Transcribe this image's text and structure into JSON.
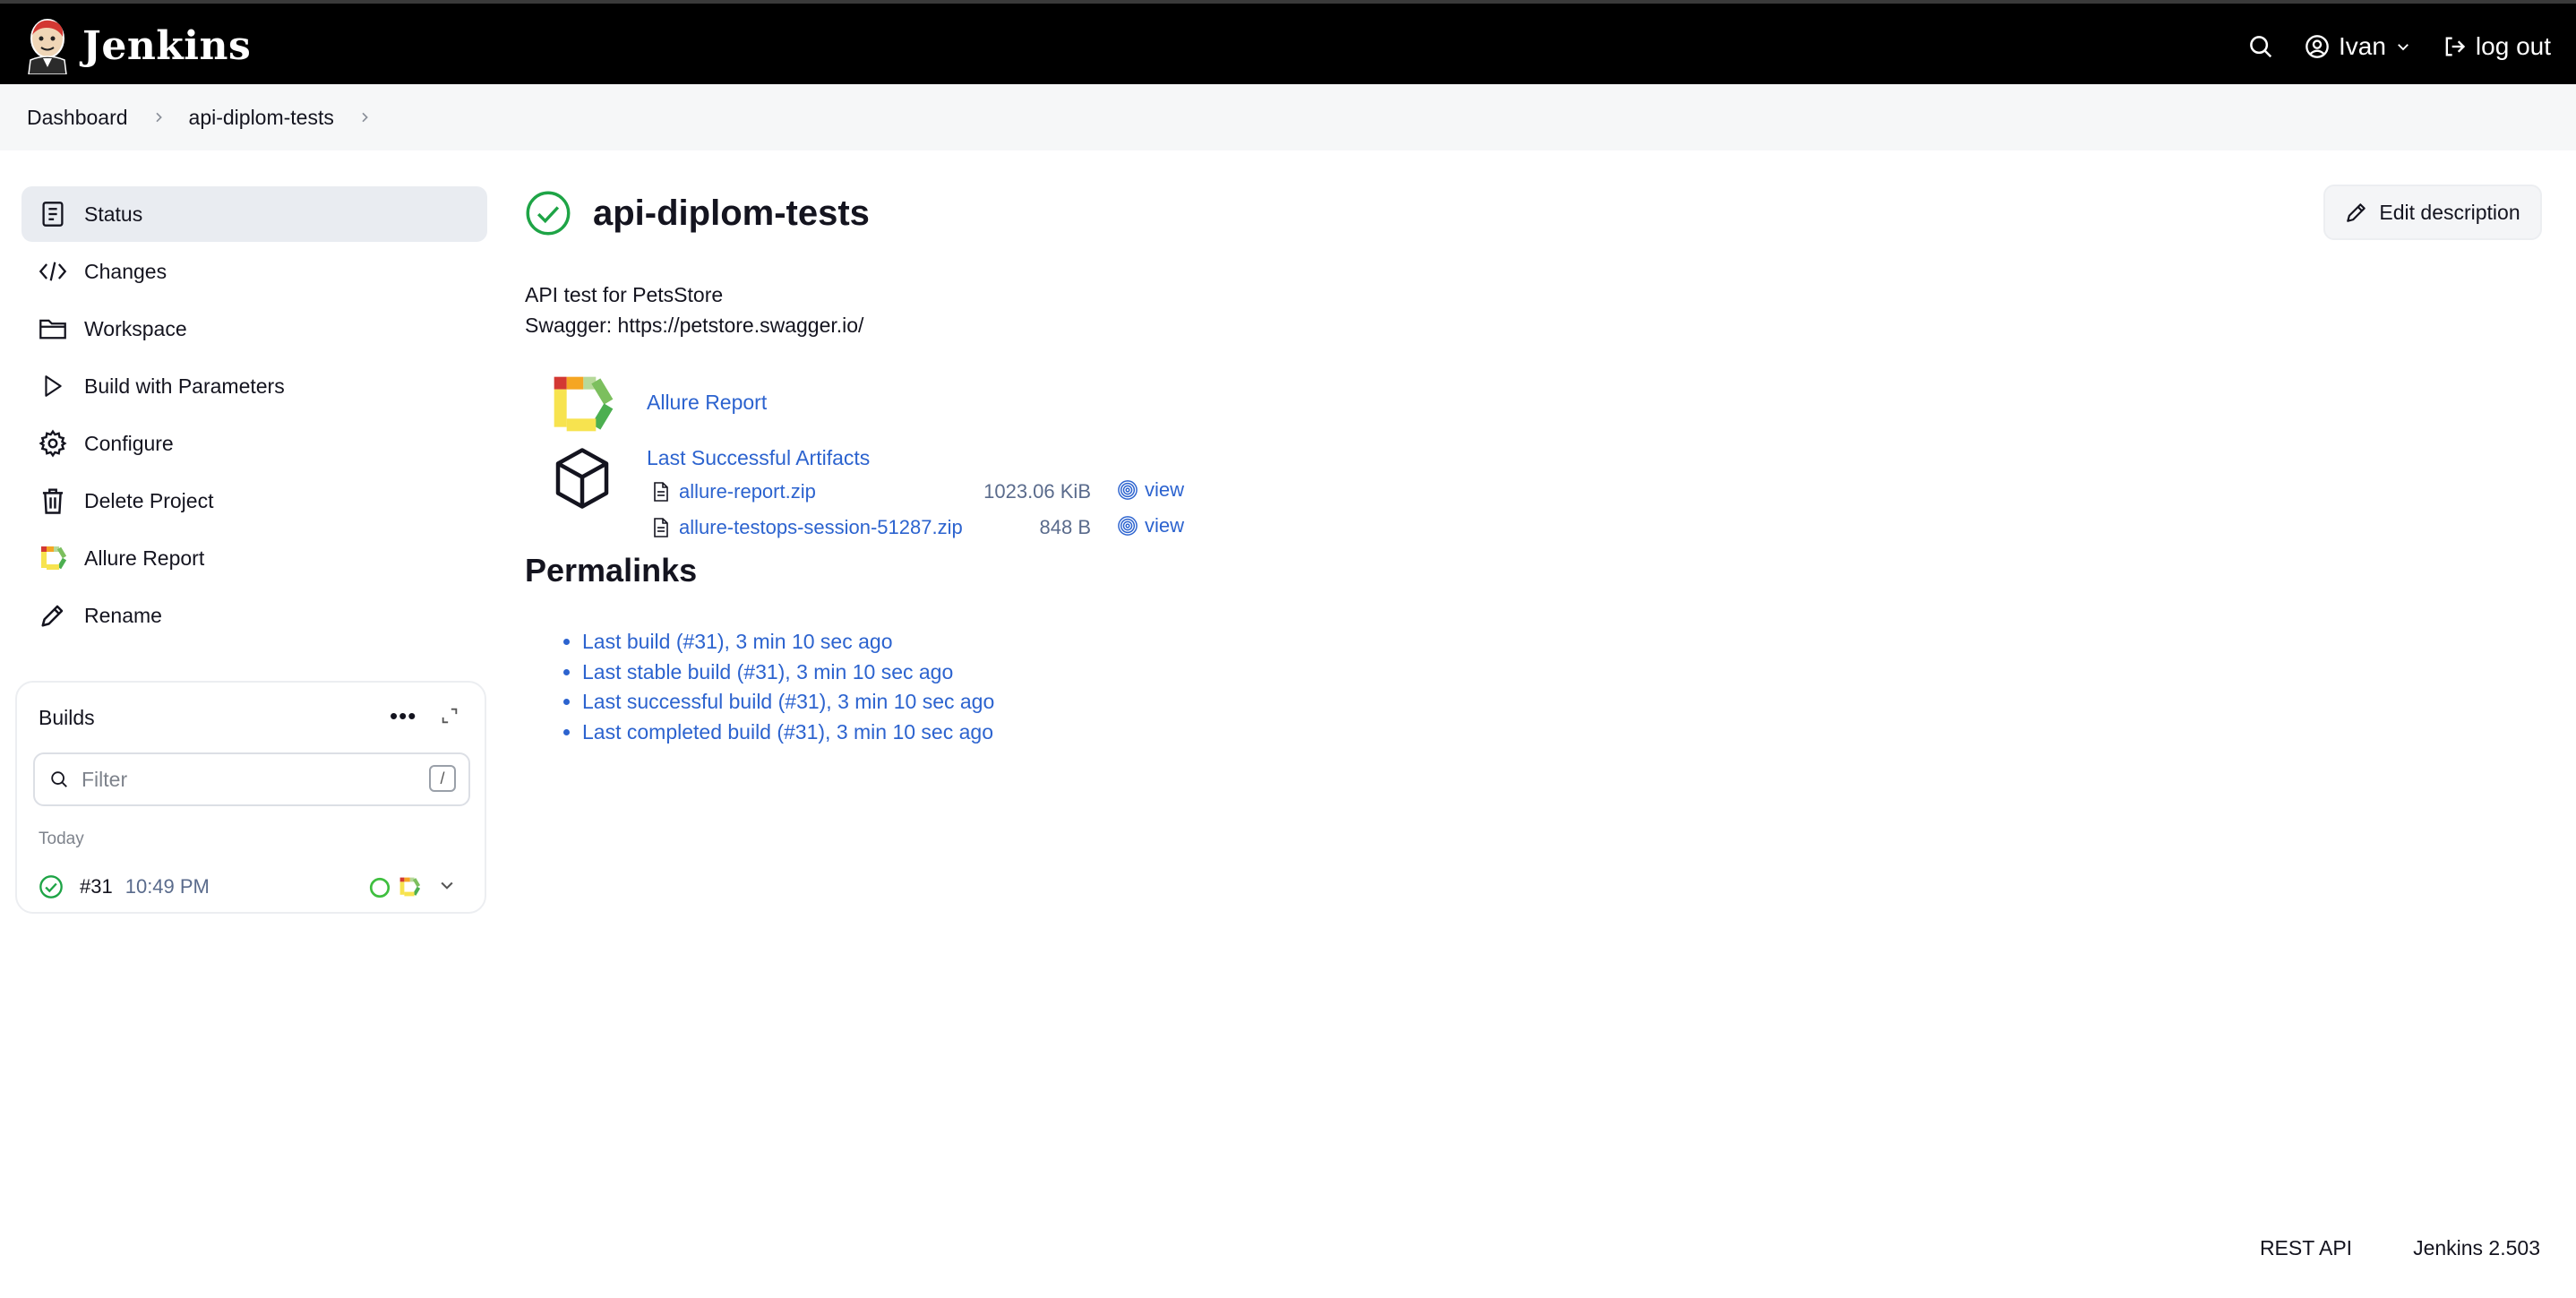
{
  "header": {
    "brand": "Jenkins",
    "user": "Ivan",
    "logout": "log out"
  },
  "breadcrumb": [
    "Dashboard",
    "api-diplom-tests"
  ],
  "sidebar": {
    "items": [
      {
        "label": "Status",
        "icon": "status-icon"
      },
      {
        "label": "Changes",
        "icon": "code-icon"
      },
      {
        "label": "Workspace",
        "icon": "folder-icon"
      },
      {
        "label": "Build with Parameters",
        "icon": "play-icon"
      },
      {
        "label": "Configure",
        "icon": "gear-icon"
      },
      {
        "label": "Delete Project",
        "icon": "trash-icon"
      },
      {
        "label": "Allure Report",
        "icon": "allure-icon"
      },
      {
        "label": "Rename",
        "icon": "pencil-icon"
      }
    ],
    "builds": {
      "title": "Builds",
      "filter_placeholder": "Filter",
      "filter_shortcut": "/",
      "group": "Today",
      "rows": [
        {
          "number": "#31",
          "time": "10:49 PM",
          "status": "success"
        }
      ]
    }
  },
  "main": {
    "title": "api-diplom-tests",
    "edit_description": "Edit description",
    "description_lines": [
      "API test for PetsStore",
      "Swagger: https://petstore.swagger.io/"
    ],
    "allure_link": "Allure Report",
    "artifacts": {
      "title": "Last Successful Artifacts",
      "files": [
        {
          "name": "allure-report.zip",
          "size": "1023.06 KiB",
          "action": "view"
        },
        {
          "name": "allure-testops-session-51287.zip",
          "size": "848 B",
          "action": "view"
        }
      ]
    },
    "permalinks_title": "Permalinks",
    "permalinks": [
      "Last build (#31), 3 min 10 sec ago",
      "Last stable build (#31), 3 min 10 sec ago",
      "Last successful build (#31), 3 min 10 sec ago",
      "Last completed build (#31), 3 min 10 sec ago"
    ]
  },
  "footer": {
    "rest_api": "REST API",
    "version": "Jenkins 2.503"
  },
  "colors": {
    "accent": "#2c63cf",
    "success": "#1ea446",
    "topbar": "#000000"
  }
}
